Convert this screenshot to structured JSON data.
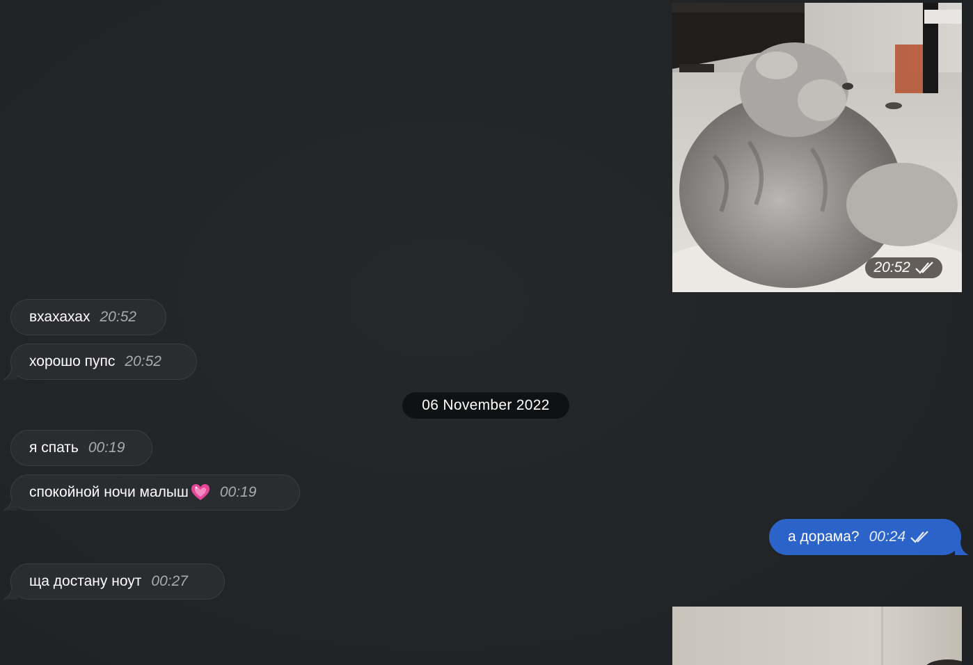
{
  "messages": {
    "m1": {
      "text": "вхахахах",
      "time": "20:52"
    },
    "m2": {
      "text": "хорошо пупс",
      "time": "20:52"
    },
    "m3": {
      "text": "я спать",
      "time": "00:19"
    },
    "m4": {
      "text": "спокойной ночи малыш",
      "time": "00:19"
    },
    "m5": {
      "text": "ща достану ноут",
      "time": "00:27"
    },
    "out1": {
      "text": "а дорама?",
      "time": "00:24"
    }
  },
  "media": {
    "video1": {
      "time": "20:52"
    }
  },
  "date_separator": "06 November 2022",
  "colors": {
    "background": "#222527",
    "incoming_bubble": "#2a2c2f",
    "outgoing_bubble": "#2c63c9",
    "date_chip": "#0f1113"
  },
  "icons": {
    "read_status": "double-check-icon",
    "emoji": "sparkling-heart-emoji"
  }
}
